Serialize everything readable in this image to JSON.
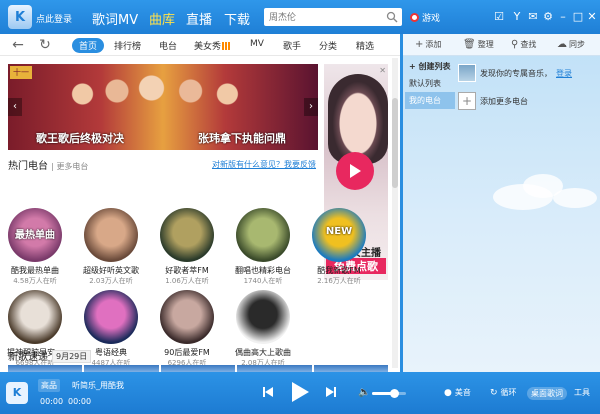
{
  "header": {
    "login_label": "点此登录",
    "tabs": [
      {
        "label": "歌词MV",
        "active": false
      },
      {
        "label": "曲库",
        "active": true
      },
      {
        "label": "直播",
        "active": false
      },
      {
        "label": "下载",
        "active": false
      }
    ],
    "search_placeholder": "周杰伦",
    "game_label": "游戏"
  },
  "subnav": {
    "tabs": [
      "首页",
      "排行榜",
      "电台",
      "美女秀",
      "MV",
      "歌手",
      "分类",
      "精选"
    ],
    "active_index": 0
  },
  "banner": {
    "tag": "十一",
    "caption_left": "歌王歌后终极对决",
    "caption_right": "张玮拿下执能问鼎"
  },
  "ad": {
    "line1": "网络女主播",
    "line2": "免费点歌"
  },
  "hot_stations": {
    "title": "热门电台",
    "more_label": "更多电台",
    "feedback_link": "对新版有什么意见？我要反馈",
    "items": [
      {
        "name": "酷我最热单曲",
        "count": "4.58万人在听",
        "colors": [
          "#7a3a6a",
          "#d27aa9"
        ],
        "label": "最热单曲"
      },
      {
        "name": "超级好听英文歌",
        "count": "2.03万人在听",
        "colors": [
          "#6a4a3a",
          "#d8a888"
        ],
        "label": ""
      },
      {
        "name": "好歌者萃FM",
        "count": "1.06万人在听",
        "colors": [
          "#2a3a2a",
          "#b0a060"
        ],
        "label": ""
      },
      {
        "name": "翻唱也精彩电台",
        "count": "1740人在听",
        "colors": [
          "#3a4a2a",
          "#a8b870"
        ],
        "label": ""
      },
      {
        "name": "酷我新歌FM",
        "count": "2.16万人在听",
        "colors": [
          "#1a7ac0",
          "#f0c020"
        ],
        "label": "NEW"
      },
      {
        "name": "提神醒脑早安...",
        "count": "6698人在听",
        "colors": [
          "#4a3a2a",
          "#e8e0d8"
        ],
        "label": ""
      },
      {
        "name": "粤语经典",
        "count": "4487人在听",
        "colors": [
          "#1a2a5a",
          "#e070c0"
        ],
        "label": ""
      },
      {
        "name": "90后最爱FM",
        "count": "6296人在听",
        "colors": [
          "#3a2a2a",
          "#c8a8a0"
        ],
        "label": ""
      },
      {
        "name": "偶曲高大上歌曲",
        "count": "2.08万人在听",
        "colors": [
          "#f0f0f0",
          "#2a2a2a"
        ],
        "label": ""
      }
    ]
  },
  "new_songs": {
    "title": "新歌速递",
    "date": "9月29日"
  },
  "right_pane": {
    "toolbar": [
      {
        "icon": "plus-icon",
        "label": "添加"
      },
      {
        "icon": "trash-icon",
        "label": "整理"
      },
      {
        "icon": "search-icon",
        "label": "查找"
      },
      {
        "icon": "sync-icon",
        "label": "同步"
      }
    ],
    "list": [
      {
        "label": "+ 创建列表",
        "selected": false
      },
      {
        "label": "默认列表",
        "selected": false
      },
      {
        "label": "我的电台",
        "selected": true
      }
    ],
    "discover_text": "发现你的专属音乐，",
    "discover_link": "登录",
    "add_station": "添加更多电台"
  },
  "player": {
    "quality": "高品",
    "title": "听简乐_用酷我",
    "time_elapsed": "00:00",
    "time_total": "00:00",
    "volume_level": 0.65,
    "effect_label": "美音",
    "loop_label": "循环",
    "lyric_label": "桌面歌词",
    "tools_label": "工具"
  },
  "colors": {
    "brand_blue": "#2a8ee0",
    "active_tab": "#ffe24a",
    "accent_pink": "#e8285f"
  }
}
